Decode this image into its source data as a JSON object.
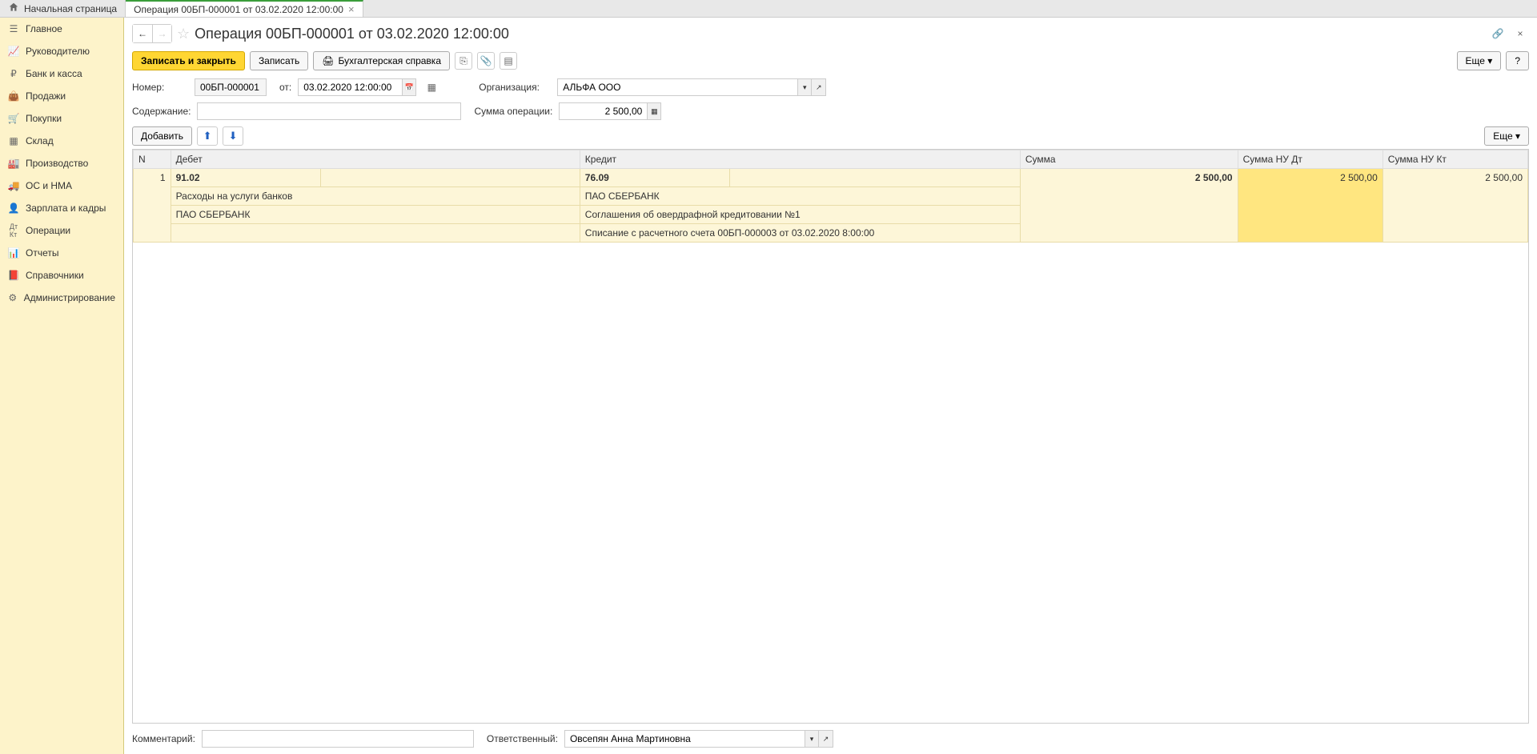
{
  "tabs": {
    "home": "Начальная страница",
    "active": "Операция 00БП-000001 от 03.02.2020 12:00:00"
  },
  "sidebar": {
    "items": [
      {
        "label": "Главное",
        "icon": "menu"
      },
      {
        "label": "Руководителю",
        "icon": "chart"
      },
      {
        "label": "Банк и касса",
        "icon": "ruble"
      },
      {
        "label": "Продажи",
        "icon": "bag"
      },
      {
        "label": "Покупки",
        "icon": "cart"
      },
      {
        "label": "Склад",
        "icon": "grid"
      },
      {
        "label": "Производство",
        "icon": "factory"
      },
      {
        "label": "ОС и НМА",
        "icon": "truck"
      },
      {
        "label": "Зарплата и кадры",
        "icon": "person"
      },
      {
        "label": "Операции",
        "icon": "dtkt"
      },
      {
        "label": "Отчеты",
        "icon": "bars"
      },
      {
        "label": "Справочники",
        "icon": "book"
      },
      {
        "label": "Администрирование",
        "icon": "gear"
      }
    ]
  },
  "header": {
    "title": "Операция 00БП-000001 от 03.02.2020 12:00:00"
  },
  "toolbar": {
    "save_close": "Записать и закрыть",
    "save": "Записать",
    "acc_ref": "Бухгалтерская справка",
    "more": "Еще",
    "help": "?"
  },
  "form": {
    "number_label": "Номер:",
    "number_value": "00БП-000001",
    "from_label": "от:",
    "date_value": "03.02.2020 12:00:00",
    "org_label": "Организация:",
    "org_value": "АЛЬФА ООО",
    "content_label": "Содержание:",
    "content_value": "",
    "sum_label": "Сумма операции:",
    "sum_value": "2 500,00"
  },
  "table_toolbar": {
    "add": "Добавить",
    "more": "Еще"
  },
  "table": {
    "headers": {
      "n": "N",
      "debit": "Дебет",
      "credit": "Кредит",
      "sum": "Сумма",
      "sum_nu_dt": "Сумма НУ Дт",
      "sum_nu_kt": "Сумма НУ Кт"
    },
    "rows": [
      {
        "n": "1",
        "debit_acc": "91.02",
        "debit_sub1": "Расходы на услуги банков",
        "debit_sub2": "ПАО СБЕРБАНК",
        "debit_sub3": "",
        "credit_acc": "76.09",
        "credit_sub1": "ПАО СБЕРБАНК",
        "credit_sub2": "Соглашения об овердрафной кредитовании №1",
        "credit_sub3": "Списание с расчетного счета 00БП-000003 от 03.02.2020 8:00:00",
        "sum": "2 500,00",
        "sum_nu_dt": "2 500,00",
        "sum_nu_kt": "2 500,00"
      }
    ]
  },
  "footer": {
    "comment_label": "Комментарий:",
    "comment_value": "",
    "responsible_label": "Ответственный:",
    "responsible_value": "Овсепян Анна Мартиновна"
  }
}
